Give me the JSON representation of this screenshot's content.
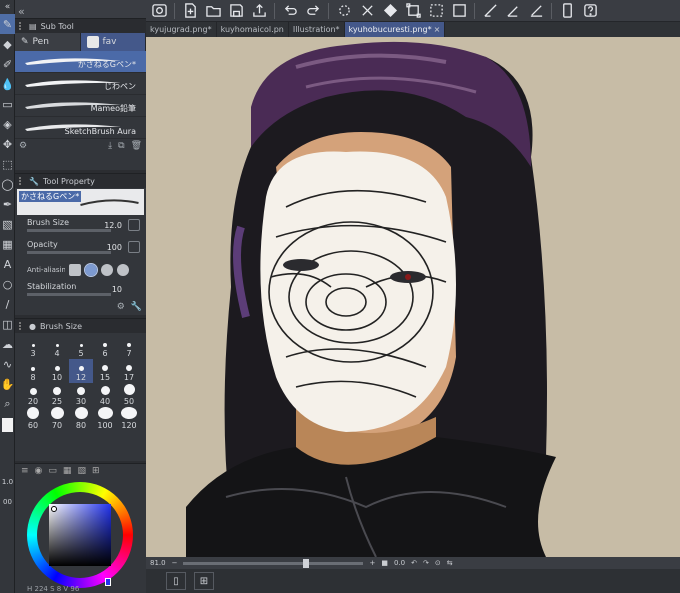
{
  "panels": {
    "sub_tool": {
      "title": "Sub Tool",
      "tabs": [
        {
          "label": "Pen",
          "active": false
        },
        {
          "label": "fav",
          "active": true
        }
      ],
      "brushes": [
        {
          "name": "かさねるGペン*",
          "selected": true
        },
        {
          "name": "じわペン",
          "selected": false
        },
        {
          "name": "Mameo鉛筆",
          "selected": false
        },
        {
          "name": "SketchBrush Aura",
          "selected": false
        }
      ]
    },
    "tool_property": {
      "title": "Tool Property",
      "preview_label": "かさねるGペン*",
      "brush_size_label": "Brush Size",
      "brush_size_value": "12.0",
      "opacity_label": "Opacity",
      "opacity_value": "100",
      "antialias_label": "Anti-aliasing",
      "stabilization_label": "Stabilization",
      "stabilization_value": "10"
    },
    "brush_size": {
      "title": "Brush Size",
      "sizes": [
        "3",
        "4",
        "5",
        "6",
        "7",
        "8",
        "10",
        "12",
        "15",
        "17",
        "20",
        "25",
        "30",
        "40",
        "50",
        "60",
        "70",
        "80",
        "100",
        "120"
      ],
      "selected": "12"
    },
    "color_wheel": {
      "footer": "H 224  S 8  V 96"
    }
  },
  "document_tabs": [
    {
      "label": "kyujugrad.png*",
      "active": false
    },
    {
      "label": "kuyhomaicol.pn",
      "active": false
    },
    {
      "label": "Illustration*",
      "active": false
    },
    {
      "label": "kyuhobucuresti.png*",
      "active": true
    }
  ],
  "status": {
    "zoom": "81.0",
    "angle": "0.0"
  },
  "left_strip_values": [
    "1.0",
    "00"
  ],
  "colors": {
    "canvas_bg": "#c7bca6",
    "accent": "#44588a",
    "panel": "#33363b"
  }
}
